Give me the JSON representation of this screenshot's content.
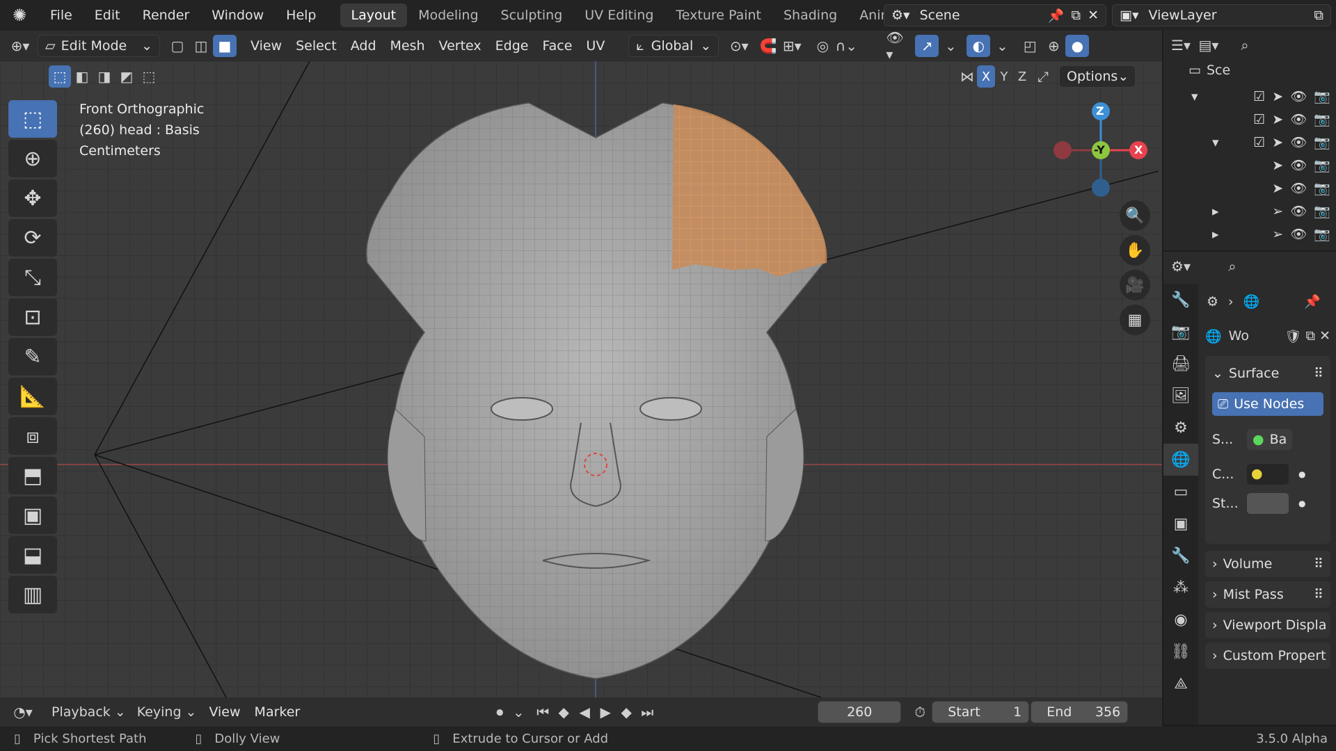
{
  "menu": [
    "File",
    "Edit",
    "Render",
    "Window",
    "Help"
  ],
  "workspaces": [
    "Layout",
    "Modeling",
    "Sculpting",
    "UV Editing",
    "Texture Paint",
    "Shading",
    "Animation"
  ],
  "scene_name": "Scene",
  "viewlayer_name": "ViewLayer",
  "header": {
    "mode": "Edit Mode",
    "menus": [
      "View",
      "Select",
      "Add",
      "Mesh",
      "Vertex",
      "Edge",
      "Face",
      "UV"
    ],
    "transform_orientation": "Global",
    "axes": [
      "X",
      "Y",
      "Z"
    ],
    "options": "Options"
  },
  "viewport": {
    "view_name": "Front Orthographic",
    "object_info": "(260) head : Basis",
    "units": "Centimeters",
    "gizmo": {
      "z": "Z",
      "y": "-Y",
      "x": "X"
    }
  },
  "outliner": {
    "scene_label": "Sce"
  },
  "properties": {
    "world_name": "Wo",
    "surface": "Surface",
    "use_nodes": "Use Nodes",
    "rows": [
      {
        "label": "S...",
        "value": "Ba"
      },
      {
        "label": "C...",
        "value": ""
      },
      {
        "label": "St...",
        "value": ""
      }
    ],
    "collapsed": [
      "Volume",
      "Mist Pass",
      "Viewport Displa",
      "Custom Propert"
    ]
  },
  "timeline": {
    "menus": [
      "Playback",
      "Keying",
      "View",
      "Marker"
    ],
    "current_frame": "260",
    "start_label": "Start",
    "start": "1",
    "end_label": "End",
    "end": "356"
  },
  "status": {
    "items": [
      "Pick Shortest Path",
      "Dolly View",
      "Extrude to Cursor or Add"
    ],
    "version": "3.5.0 Alpha"
  },
  "colors": {
    "accent": "#4772b3",
    "selection": "#e8964a",
    "x_axis": "#e8424e",
    "y_axis": "#8dc63f",
    "z_axis": "#3d8fd6"
  }
}
